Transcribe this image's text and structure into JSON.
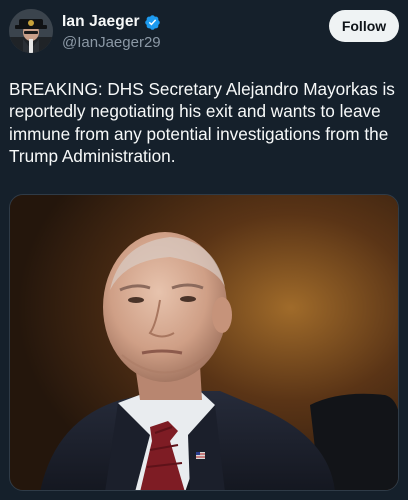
{
  "author": {
    "display_name": "Ian Jaeger",
    "handle": "@IanJaeger29",
    "verified": true,
    "avatar_icon": "profile-avatar"
  },
  "actions": {
    "follow_label": "Follow"
  },
  "tweet": {
    "text": "BREAKING: DHS Secretary Alejandro Mayorkas is reportedly negotiating his exit and wants to leave immune from any potential investigations from the Trump Administration."
  },
  "media": {
    "type": "photo",
    "subject": "man in dark suit with red tie at hearing"
  },
  "colors": {
    "background": "#15202b",
    "text_primary": "#f7f9f9",
    "text_secondary": "#8b98a5",
    "verified_badge": "#1d9bf0",
    "follow_button_bg": "#eff3f4",
    "follow_button_text": "#0f1419"
  }
}
